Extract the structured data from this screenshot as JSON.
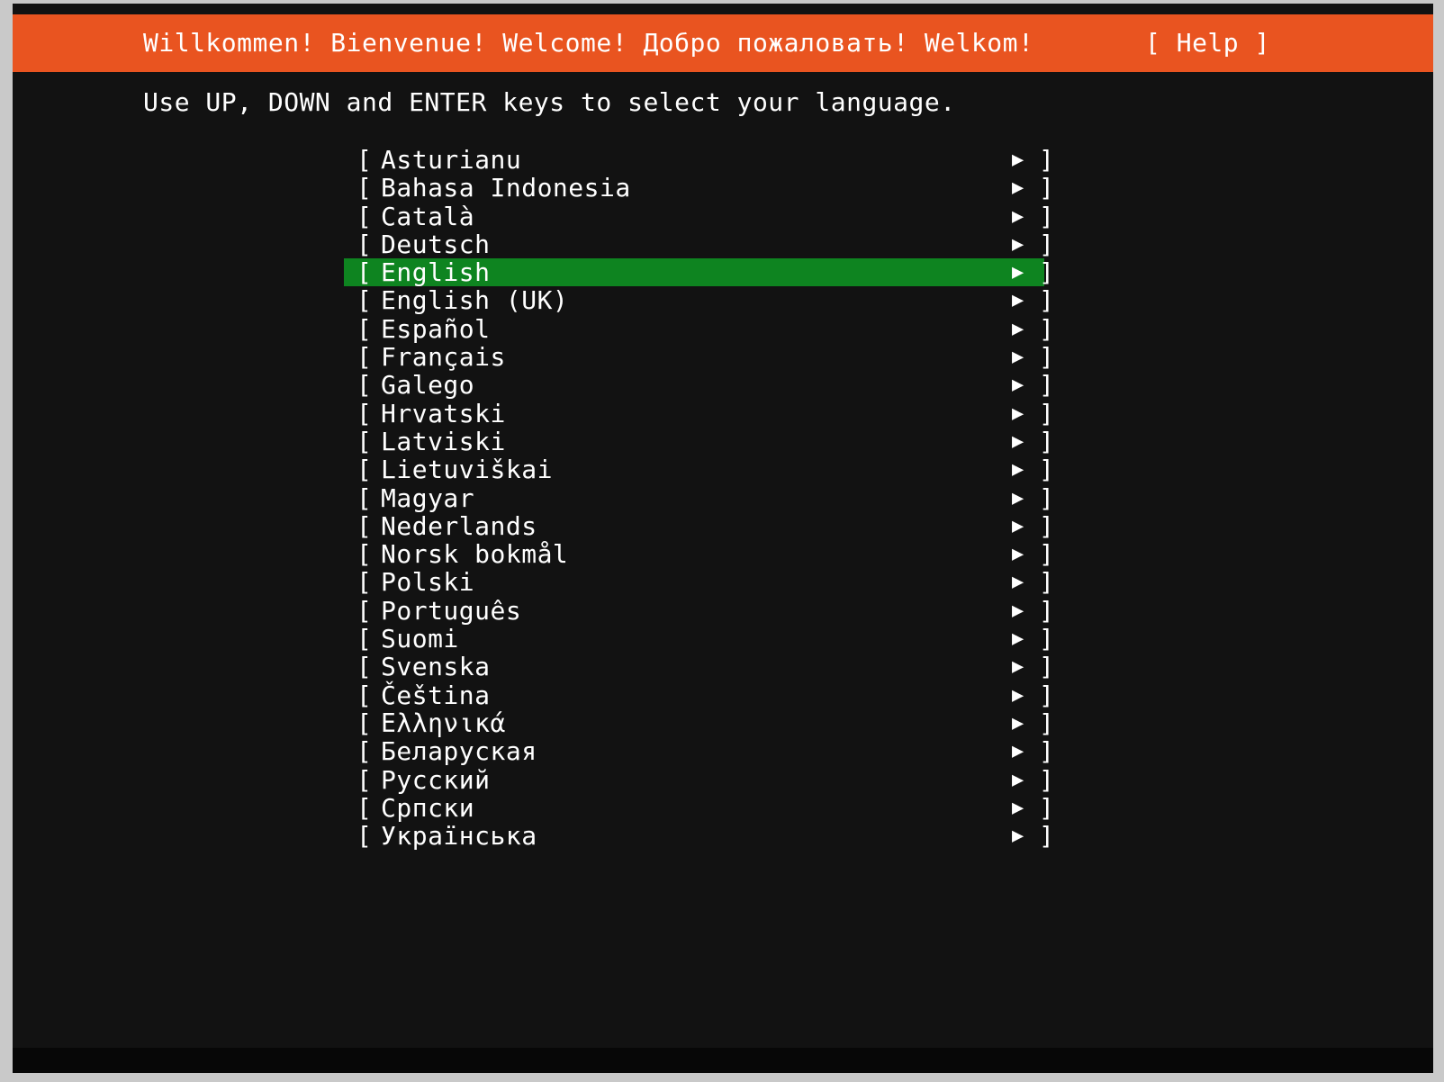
{
  "header": {
    "welcome_text": "Willkommen! Bienvenue! Welcome! Добро пожаловать! Welkom!",
    "help_label": "[ Help ]",
    "background_color": "#e95420",
    "text_color": "#ffffff"
  },
  "instructions": {
    "text": "Use UP, DOWN and ENTER keys to select your language."
  },
  "list": {
    "bracket_open": "[",
    "bracket_close": "]",
    "expand_icon": "▶",
    "selected_index": 4,
    "selected_background_color": "#0e8420",
    "items": [
      {
        "label": "Asturianu"
      },
      {
        "label": "Bahasa Indonesia"
      },
      {
        "label": "Català"
      },
      {
        "label": "Deutsch"
      },
      {
        "label": "English"
      },
      {
        "label": "English (UK)"
      },
      {
        "label": "Español"
      },
      {
        "label": "Français"
      },
      {
        "label": "Galego"
      },
      {
        "label": "Hrvatski"
      },
      {
        "label": "Latviski"
      },
      {
        "label": "Lietuviškai"
      },
      {
        "label": "Magyar"
      },
      {
        "label": "Nederlands"
      },
      {
        "label": "Norsk bokmål"
      },
      {
        "label": "Polski"
      },
      {
        "label": "Português"
      },
      {
        "label": "Suomi"
      },
      {
        "label": "Svenska"
      },
      {
        "label": "Čeština"
      },
      {
        "label": "Ελληνικά"
      },
      {
        "label": "Беларуская"
      },
      {
        "label": "Русский"
      },
      {
        "label": "Српски"
      },
      {
        "label": "Українська"
      }
    ]
  },
  "terminal": {
    "background_color": "#121212",
    "foreground_color": "#ffffff"
  }
}
